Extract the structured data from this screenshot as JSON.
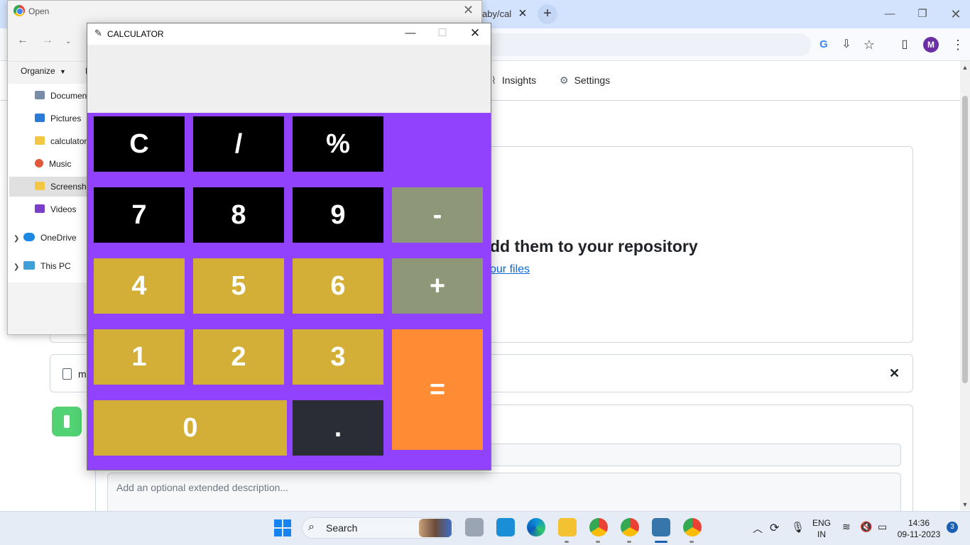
{
  "browser": {
    "tab_partial_title": "aby/cal",
    "new_tab_symbol": "+",
    "profile_initial": "M",
    "nav": {
      "insights": "Insights",
      "settings": "Settings"
    },
    "repo_heading_partial": "dd them to your repository",
    "repo_link_partial": "our files",
    "file_row_partial": "m",
    "description_placeholder": "Add an optional extended description..."
  },
  "open_dialog": {
    "title": "Open",
    "organize_label": "Organize",
    "folder_partial": "I",
    "sidebar": [
      {
        "label": "Documen",
        "icon": "document-icon",
        "color": "#7a8da8"
      },
      {
        "label": "Pictures",
        "icon": "pictures-icon",
        "color": "#2b7bd6"
      },
      {
        "label": "calculator",
        "icon": "folder-icon",
        "color": "#f2c744"
      },
      {
        "label": "Music",
        "icon": "music-icon",
        "color": "#e0593a"
      },
      {
        "label": "Screensho",
        "icon": "folder-icon",
        "color": "#f2c744",
        "selected": true
      },
      {
        "label": "Videos",
        "icon": "videos-icon",
        "color": "#7a3fc9"
      },
      {
        "label": "OneDrive",
        "icon": "onedrive-icon",
        "color": "#1e88e5",
        "expandable": true
      },
      {
        "label": "This PC",
        "icon": "this-pc-icon",
        "color": "#3fa0d9",
        "expandable": true
      }
    ]
  },
  "calculator": {
    "title": "CALCULATOR",
    "display_value": "",
    "keys": {
      "clear": "C",
      "divide": "/",
      "percent": "%",
      "seven": "7",
      "eight": "8",
      "nine": "9",
      "minus": "-",
      "four": "4",
      "five": "5",
      "six": "6",
      "plus": "+",
      "one": "1",
      "two": "2",
      "three": "3",
      "equals": "=",
      "zero": "0",
      "dot": "."
    },
    "colors": {
      "background": "#9042fc",
      "black_key": "#000000",
      "gold_key": "#d4af37",
      "gray_key": "#8f9779",
      "dark_key": "#2a2d36",
      "orange_key": "#ff8c34"
    }
  },
  "taskbar": {
    "search_label": "Search",
    "language": "ENG",
    "region": "IN",
    "time": "14:36",
    "date": "09-11-2023",
    "notification_count": "3"
  }
}
